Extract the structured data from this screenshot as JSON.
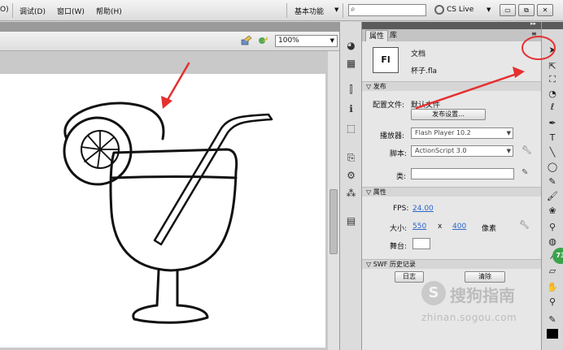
{
  "menubar": {
    "items": [
      {
        "label": "O)"
      },
      {
        "label": "调试(D)"
      },
      {
        "label": "窗口(W)"
      },
      {
        "label": "帮助(H)"
      }
    ],
    "workspace_label": "基本功能",
    "search_placeholder": "",
    "cslive_label": "CS Live",
    "window_buttons": [
      "▭",
      "⧉",
      "✕"
    ]
  },
  "editbar": {
    "zoom_value": "100%"
  },
  "properties_panel": {
    "tabs": [
      "属性",
      "库"
    ],
    "doc_icon_text": "Fl",
    "doc_type": "文档",
    "file_name": "杯子.fla",
    "publish_section": {
      "header": "发布",
      "profile_label": "配置文件:",
      "profile_value": "默认文件",
      "publish_settings_button": "发布设置...",
      "player_label": "播放器:",
      "player_value": "Flash Player 10.2",
      "script_label": "脚本:",
      "script_value": "ActionScript 3.0",
      "class_label": "类:",
      "class_value": ""
    },
    "properties_section": {
      "header": "属性",
      "fps_label": "FPS:",
      "fps_value": "24.00",
      "size_label": "大小:",
      "width_value": "550",
      "size_x": "x",
      "height_value": "400",
      "unit_label": "像素",
      "stage_label": "舞台:",
      "stage_color": "#ffffff"
    },
    "swf_history_section": {
      "header": "SWF 历史记录",
      "log_button": "日志",
      "clear_button": "清除"
    }
  },
  "badge_value": "73",
  "watermark": {
    "logo_letter": "S",
    "text": "搜狗指南",
    "url": "zhinan.sogou.com"
  },
  "colors": {
    "annotation_red": "#e53030",
    "badge_green": "#3aa34a",
    "link_blue": "#2a66c8"
  },
  "icons": {
    "right_toolbar": [
      "selection-tool-icon",
      "subselection-tool-icon",
      "free-transform-tool-icon",
      "3d-rotation-tool-icon",
      "lasso-tool-icon",
      "pen-tool-icon",
      "text-tool-icon",
      "line-tool-icon",
      "rectangle-tool-icon",
      "pencil-tool-icon",
      "brush-tool-icon",
      "deco-tool-icon",
      "bone-tool-icon",
      "paint-bucket-tool-icon",
      "eyedropper-tool-icon",
      "eraser-tool-icon",
      "hand-tool-icon",
      "zoom-tool-icon",
      "stroke-color-icon",
      "fill-color-icon"
    ]
  }
}
